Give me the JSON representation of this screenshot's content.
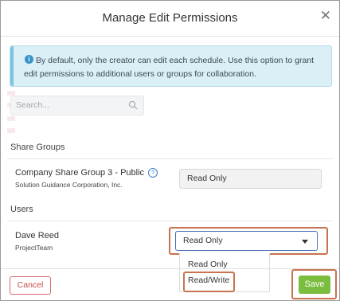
{
  "modal": {
    "title": "Manage Edit Permissions",
    "close_icon": "close-icon",
    "info_text": "By default, only the creator can edit each schedule. Use this option to grant edit permissions to additional users or groups for collaboration."
  },
  "search": {
    "placeholder": "Search..."
  },
  "share_groups": {
    "label": "Share Groups",
    "items": [
      {
        "name": "Company Share Group 3 - Public",
        "org": "Solution Guidance Corporation, Inc.",
        "permission": "Read Only"
      }
    ]
  },
  "users": {
    "label": "Users",
    "items": [
      {
        "name": "Dave Reed",
        "org": "ProjectTeam",
        "permission": "Read Only"
      }
    ]
  },
  "dropdown": {
    "options": [
      "Read Only",
      "Read/Write"
    ]
  },
  "footer": {
    "cancel_label": "Cancel",
    "save_label": "Save"
  },
  "colors": {
    "save": "#7bbd3e",
    "cancel": "#c94b4b",
    "info_bg": "#dbeff7",
    "highlight": "#c8734f"
  }
}
